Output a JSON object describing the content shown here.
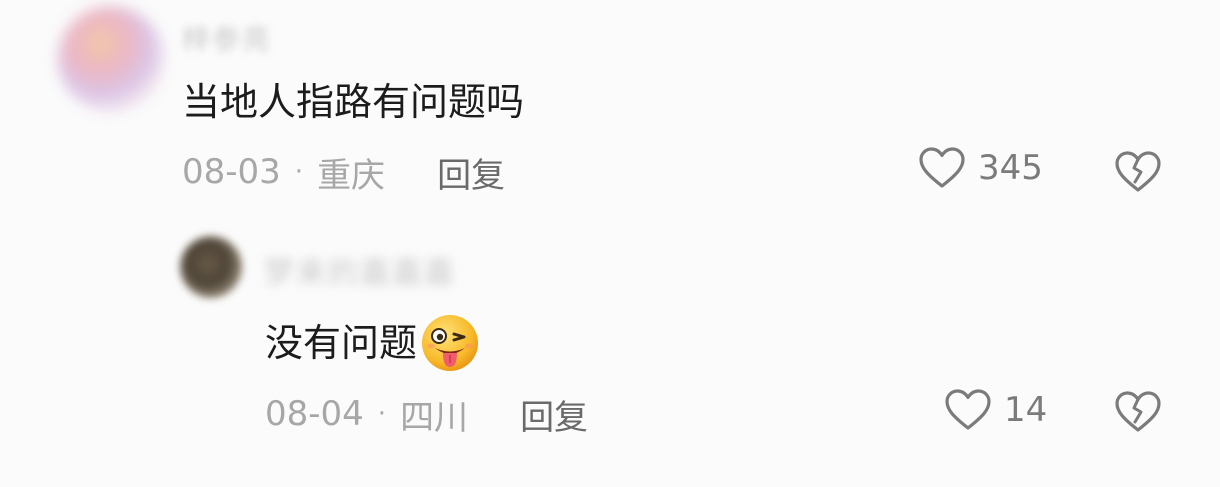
{
  "comment": {
    "username": "梓参亮",
    "text": "当地人指路有问题吗",
    "date": "08-03",
    "separator": "·",
    "location": "重庆",
    "reply_label": "回复",
    "like_count": "345",
    "icons": {
      "like": "heart-outline-icon",
      "dislike": "broken-heart-icon"
    }
  },
  "reply": {
    "username": "梦来的嘉嘉嘉",
    "text": "没有问题",
    "emoji": "winking-tongue-emoji",
    "date": "08-04",
    "separator": "·",
    "location": "四川",
    "reply_label": "回复",
    "like_count": "14",
    "icons": {
      "like": "heart-outline-icon",
      "dislike": "broken-heart-icon"
    }
  },
  "colors": {
    "background": "#fbfbfb",
    "text_primary": "#1c1c1c",
    "text_secondary": "#a7a7a7",
    "reply_text": "#6a6a6a",
    "like_text": "#7b7b7b"
  }
}
